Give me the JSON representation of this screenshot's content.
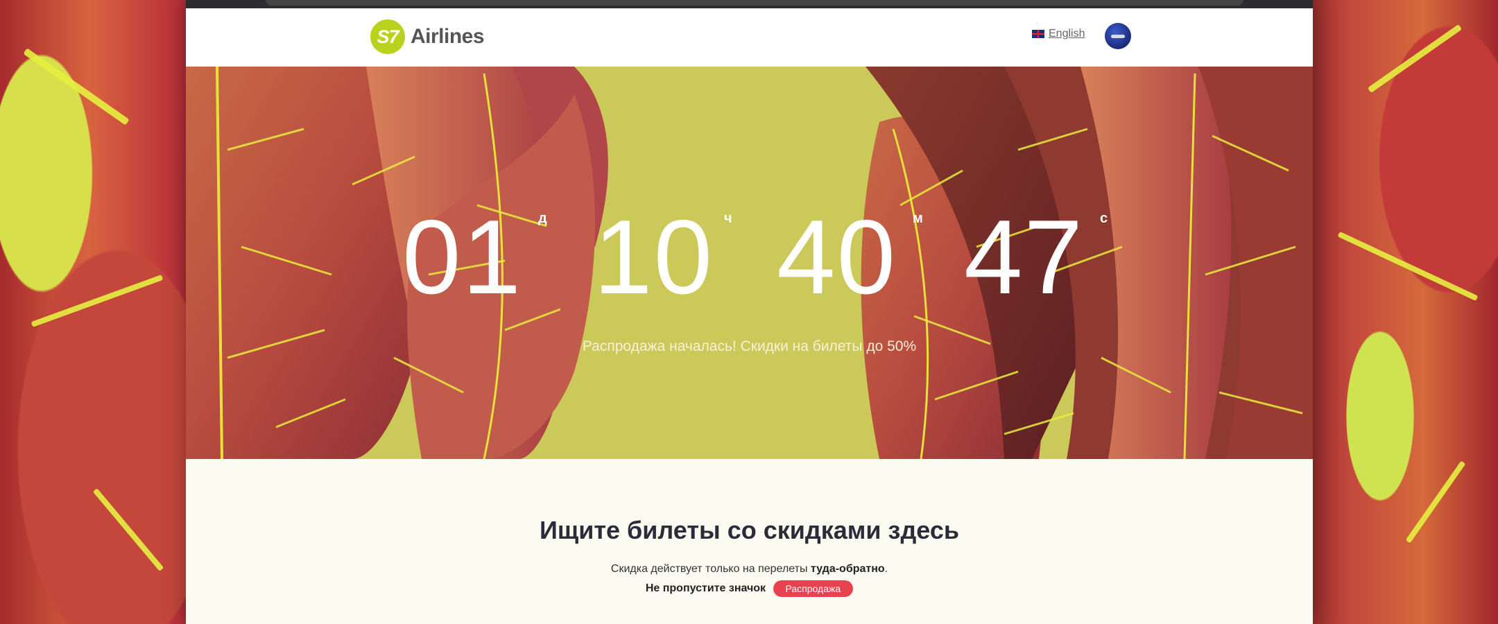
{
  "header": {
    "logo_mark": "S7",
    "logo_text": "Airlines",
    "language_label": "English",
    "alliance_icon": "oneworld-icon"
  },
  "hero": {
    "countdown": {
      "days": "01",
      "days_label": "д",
      "hours": "10",
      "hours_label": "ч",
      "minutes": "40",
      "minutes_label": "м",
      "seconds": "47",
      "seconds_label": "с"
    },
    "promo_text": "Распродажа началась! Скидки на билеты до 50%"
  },
  "search_section": {
    "title": "Ищите билеты со скидками здесь",
    "note_prefix": "Скидка действует только на перелеты ",
    "note_bold": "туда-обратно",
    "note_suffix": ".",
    "badge_prompt": "Не пропустите значок",
    "badge_label": "Распродажа"
  },
  "colors": {
    "brand_green": "#b8d21e",
    "sale_badge": "#e8414f",
    "hero_background": "#ccc95a"
  }
}
